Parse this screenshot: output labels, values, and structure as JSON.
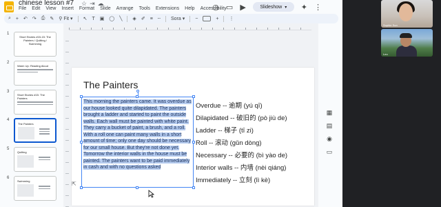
{
  "app": {
    "doc_title": "chinese lesson #7",
    "menu": [
      "File",
      "Edit",
      "View",
      "Insert",
      "Format",
      "Slide",
      "Arrange",
      "Tools",
      "Extensions",
      "Help",
      "Accessibility"
    ],
    "slideshow_label": "Slideshow"
  },
  "toolbar": {
    "zoom": "Fit",
    "font": "Sora"
  },
  "sidebar": {
    "slides": [
      {
        "num": "1",
        "title": "Short Stories #15-15: The Painters / Quilting / Swimming"
      },
      {
        "num": "2",
        "title": "Warm Up: Reading Aloud"
      },
      {
        "num": "3",
        "title": "Short Stories #15: The Painters"
      },
      {
        "num": "4",
        "title": "The Painters"
      },
      {
        "num": "5",
        "title": "Quilting"
      },
      {
        "num": "6",
        "title": "Swimming"
      }
    ]
  },
  "slide": {
    "title": "The Painters",
    "body": "This morning the painters came. It was overdue as our house looked quite dilapidated. The painters brought a ladder and started to paint the outside walls. Each wall must be painted with white paint. They carry a bucket of paint, a brush, and a roll. With a roll one can paint many walls in a short amount of time; only one day should be necessary for our small house. But they're not done yet. Tomorrow the interior walls in the house must be painted. The painters want to be paid immediately in cash and with no questions asked",
    "vocab": [
      "Overdue -- 逾期 (yú qī)",
      "Dilapidated -- 破旧的 (pò jiù de)",
      "Ladder -- 梯子 (tī zi)",
      "Roll -- 滚动 (gǔn dòng)",
      "Necessary -- 必要的 (bì yào de)",
      "Interior walls -- 内墙 (nèi qiáng)",
      "Immediately -- 立刻 (lì kè)"
    ]
  },
  "video": {
    "participant_1": "Sophie Sun",
    "participant_2": "Leo"
  }
}
